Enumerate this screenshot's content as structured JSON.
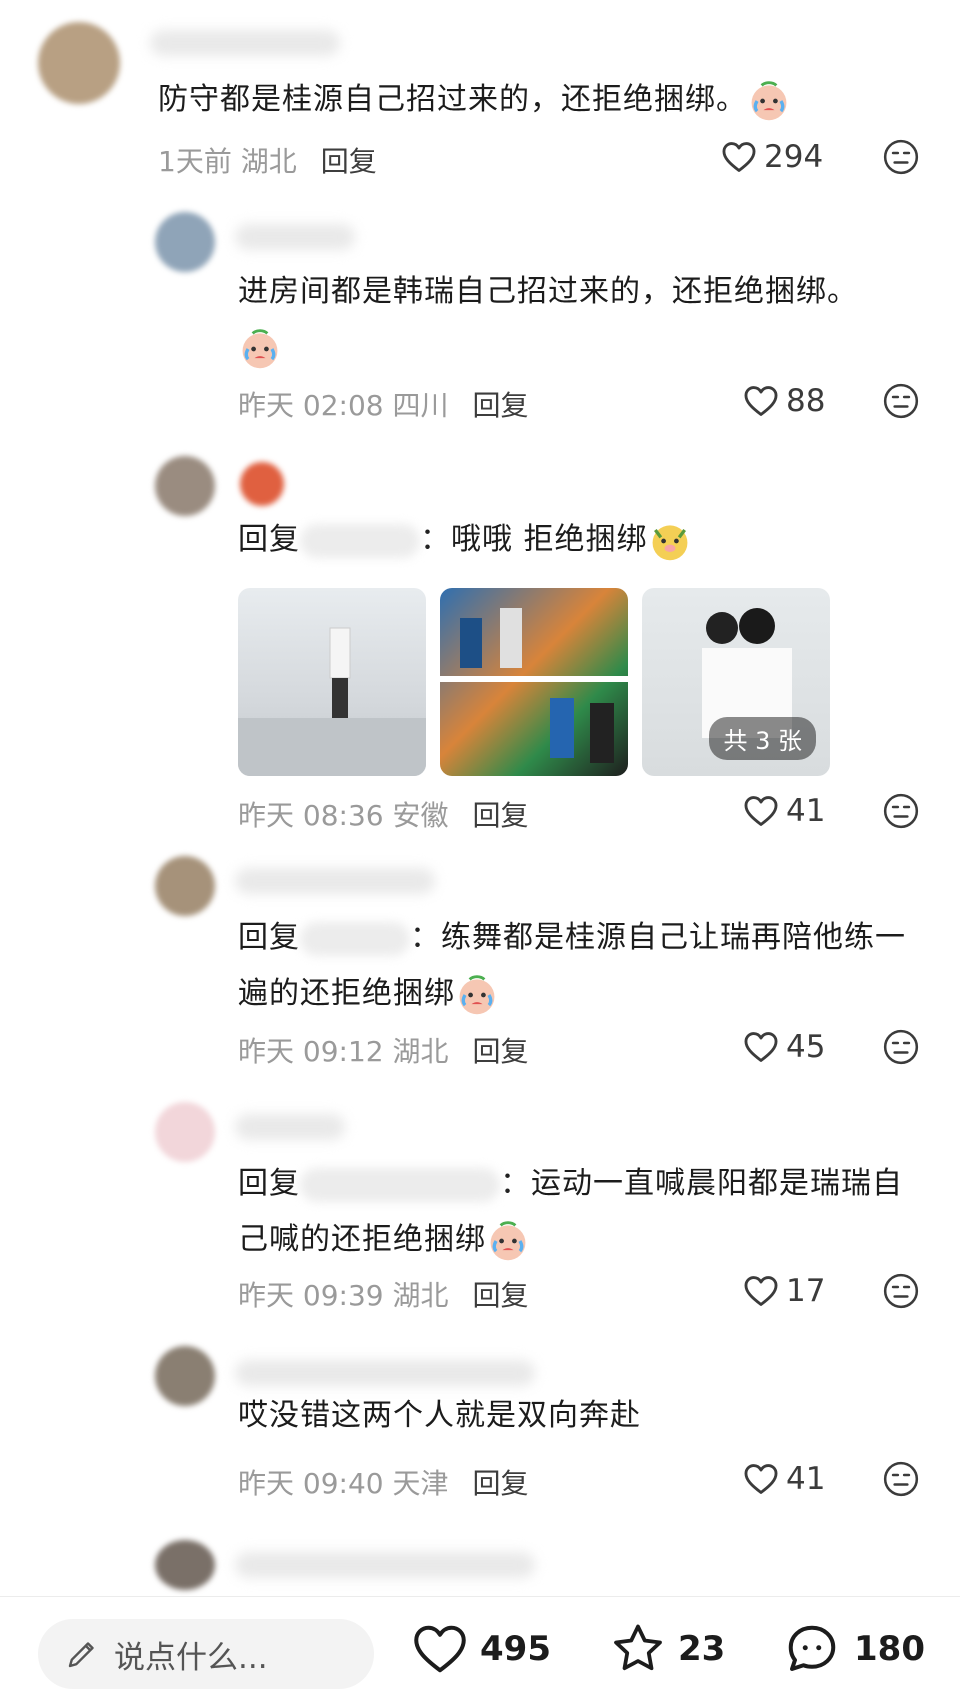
{
  "comments": [
    {
      "text": "防守都是桂源自己招过来的，还拒绝捆绑。",
      "time": "1天前",
      "location": "湖北",
      "reply_label": "回复",
      "likes": "294"
    },
    {
      "text": "进房间都是韩瑞自己招过来的，还拒绝捆绑。",
      "time": "昨天 02:08",
      "location": "四川",
      "reply_label": "回复",
      "likes": "88"
    },
    {
      "reply_prefix": "回复",
      "text": "：哦哦 拒绝捆绑",
      "time": "昨天 08:36",
      "location": "安徽",
      "reply_label": "回复",
      "likes": "41",
      "image_count_label": "共 3 张"
    },
    {
      "reply_prefix": "回复",
      "text": "：练舞都是桂源自己让瑞再陪他练一遍的还拒绝捆绑",
      "time": "昨天 09:12",
      "location": "湖北",
      "reply_label": "回复",
      "likes": "45"
    },
    {
      "reply_prefix": "回复",
      "text": "：运动一直喊晨阳都是瑞瑞自己喊的还拒绝捆绑",
      "time": "昨天 09:39",
      "location": "湖北",
      "reply_label": "回复",
      "likes": "17"
    },
    {
      "text": "哎没错这两个人就是双向奔赴",
      "time": "昨天 09:40",
      "location": "天津",
      "reply_label": "回复",
      "likes": "41"
    }
  ],
  "bottom_bar": {
    "input_placeholder": "说点什么...",
    "likes": "495",
    "favorites": "23",
    "comments": "180"
  },
  "colors": {
    "meta": "#9a9a9a",
    "text": "#1c1c1c",
    "input_bg": "#f3f3f3"
  },
  "icons": [
    "heart-icon",
    "emoji-icon",
    "pencil-icon",
    "star-icon",
    "comment-bubble-icon",
    "crying-emoji",
    "dog-emoji"
  ]
}
